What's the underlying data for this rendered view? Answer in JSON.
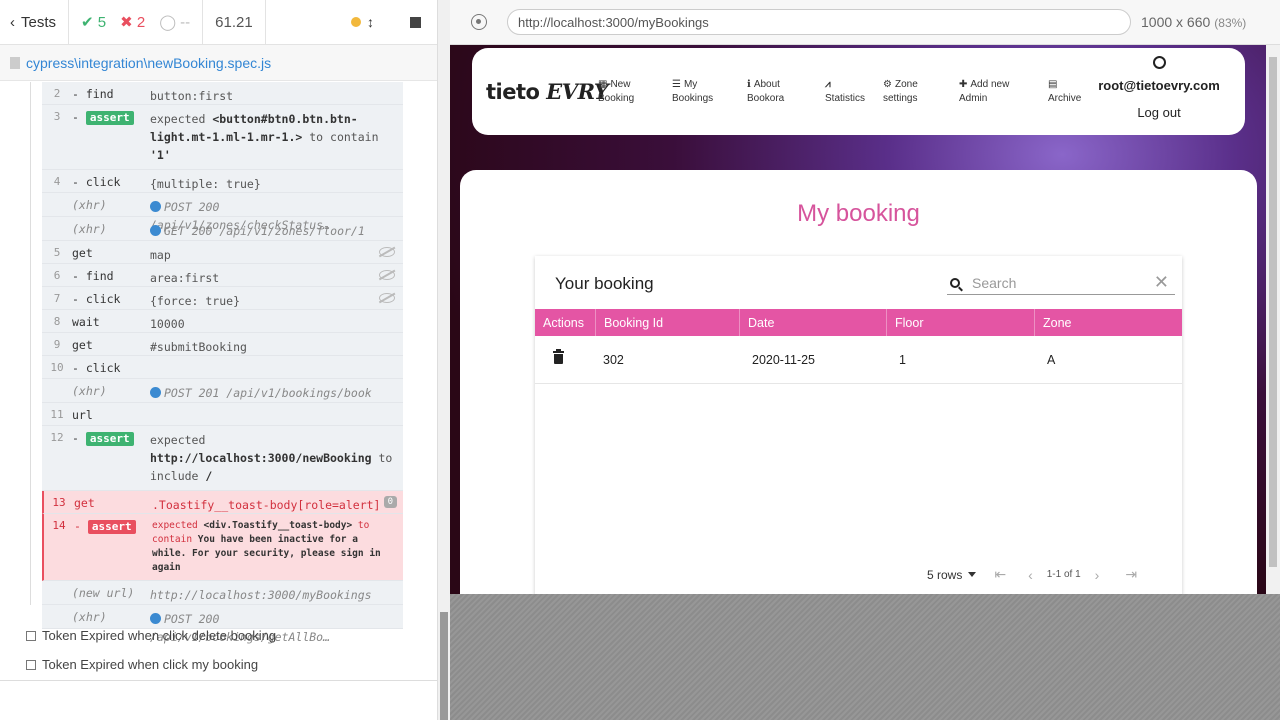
{
  "reporter": {
    "tests_label": "Tests",
    "passed": "5",
    "failed": "2",
    "pending": "--",
    "duration": "61.21",
    "spec_file": "cypress\\integration\\newBooking.spec.js",
    "commands": [
      {
        "num": "2",
        "name": "- find",
        "msg": "button:first"
      },
      {
        "num": "3",
        "name": "assert",
        "msg_pre": "expected ",
        "msg_b1": "<button#btn0.btn.btn-light.mt-1.ml-1.mr-1.>",
        "msg_mid": " to contain ",
        "msg_b2": "'1'"
      },
      {
        "num": "4",
        "name": "- click",
        "msg": "{multiple: true}"
      },
      {
        "name": "(xhr)",
        "msg": "POST 200 /api/v1/zones/checkStatus…"
      },
      {
        "name": "(xhr)",
        "msg": "GET 200 /api/v1/zones/floor/1"
      },
      {
        "num": "5",
        "name": "get",
        "msg": "map"
      },
      {
        "num": "6",
        "name": "- find",
        "msg": "area:first"
      },
      {
        "num": "7",
        "name": "- click",
        "msg": "{force: true}"
      },
      {
        "num": "8",
        "name": "wait",
        "msg": "10000"
      },
      {
        "num": "9",
        "name": "get",
        "msg": "#submitBooking"
      },
      {
        "num": "10",
        "name": "- click",
        "msg": ""
      },
      {
        "name": "(xhr)",
        "msg": "POST 201 /api/v1/bookings/book"
      },
      {
        "num": "11",
        "name": "url",
        "msg": ""
      },
      {
        "num": "12",
        "name": "assert",
        "msg_pre": "expected ",
        "msg_b1": "http://localhost:3000/newBooking",
        "msg_mid": " to include ",
        "msg_b2": "/"
      },
      {
        "num": "13",
        "name": "get",
        "msg": ".Toastify__toast-body[role=alert]",
        "badge": "0"
      },
      {
        "num": "14",
        "name": "assert",
        "msg_pre": "expected ",
        "msg_b1": "<div.Toastify__toast-body>",
        "msg_mid": " to contain ",
        "msg_b2": "You have been inactive for a while. For your security, please sign in again"
      },
      {
        "name": "(new url)",
        "msg": "http://localhost:3000/myBookings"
      },
      {
        "name": "(xhr)",
        "msg": "POST 200 /api/v1/bookings/getAllBo…"
      }
    ],
    "pending_tests": [
      "Token Expired when click delete booking",
      "Token Expired when click my booking"
    ]
  },
  "aut": {
    "url": "http://localhost:3000/myBookings",
    "viewport": "1000 x 660",
    "scale": "(83%)",
    "logo_a": "tieto",
    "logo_b": "EVRY",
    "nav": [
      {
        "l1": "New",
        "l2": "Booking",
        "icon": "calendar-icon"
      },
      {
        "l1": "My",
        "l2": "Bookings",
        "icon": "list-icon"
      },
      {
        "l1": "About",
        "l2": "Bookora",
        "icon": "info-icon"
      },
      {
        "l1": "",
        "l2": "Statistics",
        "icon": "chart-icon"
      },
      {
        "l1": "Zone",
        "l2": "settings",
        "icon": "gear-icon"
      },
      {
        "l1": "Add new",
        "l2": "Admin",
        "icon": "add-user-icon"
      },
      {
        "l1": "",
        "l2": "Archive",
        "icon": "archive-icon"
      }
    ],
    "user_email": "root@tietoevry.com",
    "logout": "Log out",
    "page_title": "My booking",
    "table_title": "Your booking",
    "search_placeholder": "Search",
    "columns": [
      "Actions",
      "Booking Id",
      "Date",
      "Floor",
      "Zone"
    ],
    "row": {
      "booking_id": "302",
      "date": "2020-11-25",
      "floor": "1",
      "zone": "A"
    },
    "pager": {
      "rows": "5 rows",
      "info": "1-1 of 1"
    },
    "colors": {
      "accent": "#e455a4",
      "title": "#d6549c"
    }
  }
}
